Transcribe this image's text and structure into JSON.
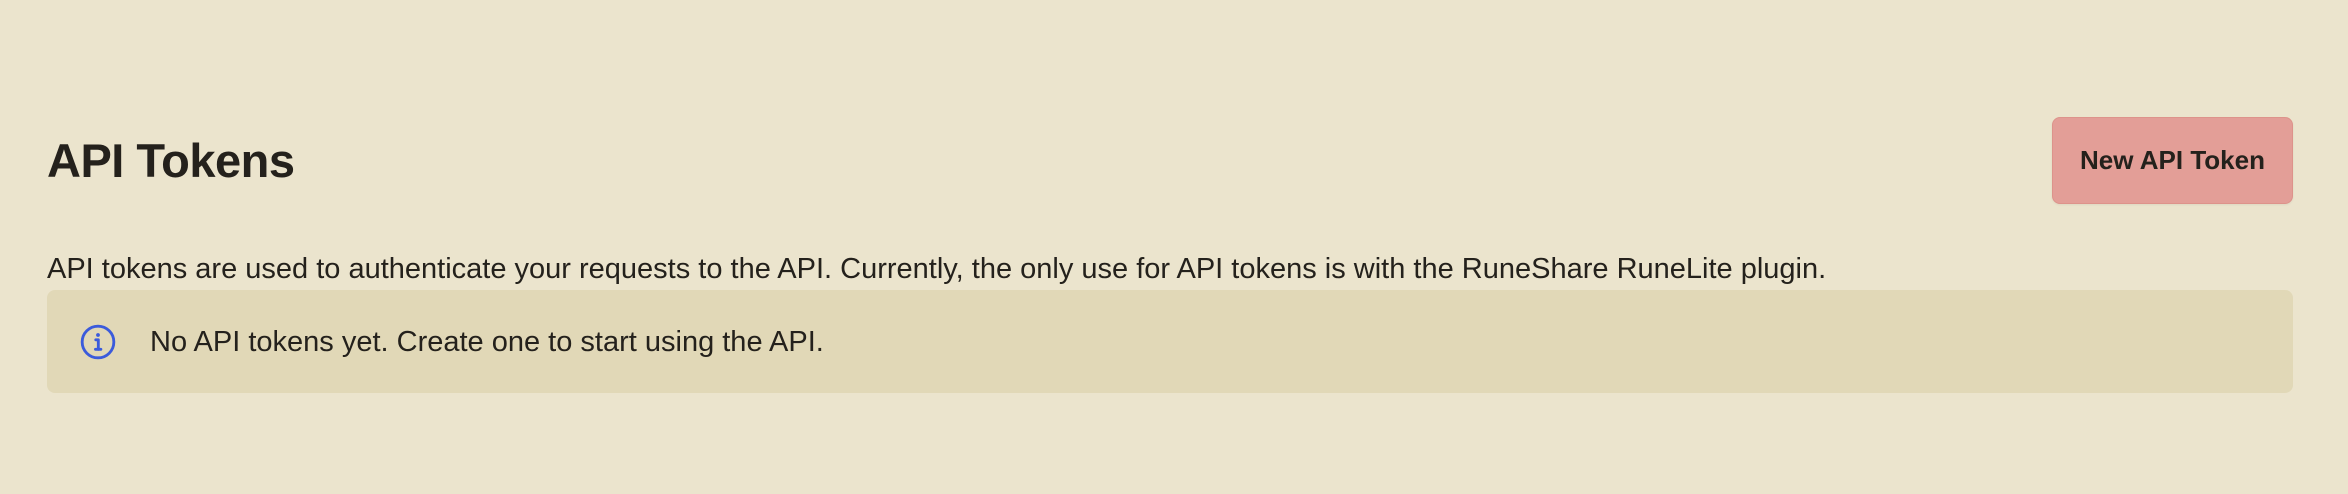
{
  "header": {
    "title": "API Tokens",
    "new_token_label": "New API Token"
  },
  "main": {
    "description": "API tokens are used to authenticate your requests to the API. Currently, the only use for API tokens is with the RuneShare RuneLite plugin.",
    "alert": {
      "icon": "info-icon",
      "message": "No API tokens yet. Create one to start using the API."
    }
  },
  "colors": {
    "background": "#ebe4cd",
    "alert_background": "#e1d8b7",
    "button_background": "#e39e97",
    "text": "#24211c",
    "info_icon": "#3b5bdb"
  }
}
